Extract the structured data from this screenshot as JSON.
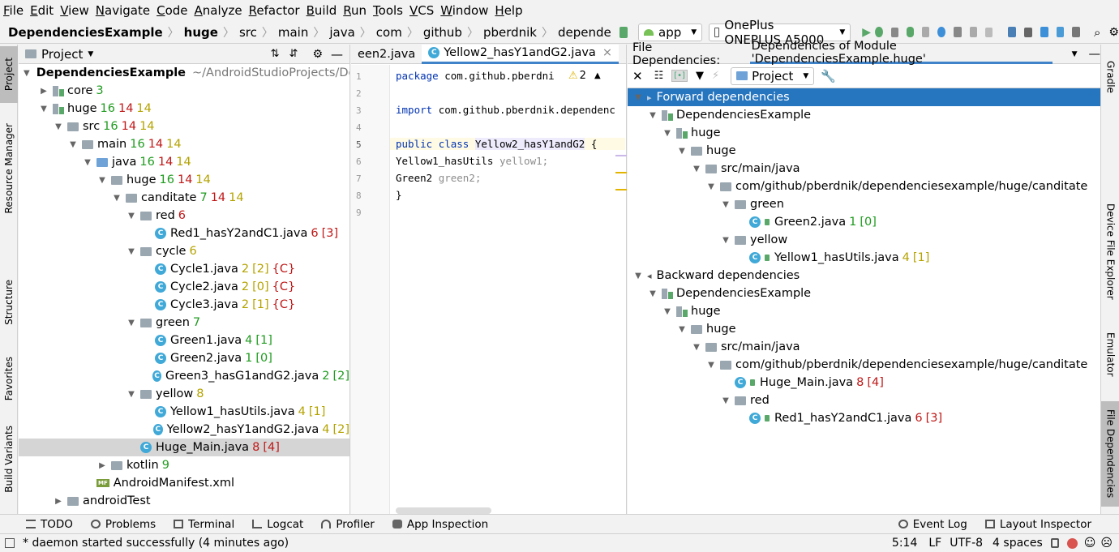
{
  "menu": [
    "File",
    "Edit",
    "View",
    "Navigate",
    "Code",
    "Analyze",
    "Refactor",
    "Build",
    "Run",
    "Tools",
    "VCS",
    "Window",
    "Help"
  ],
  "breadcrumbs": [
    "DependenciesExample",
    "huge",
    "src",
    "main",
    "java",
    "com",
    "github",
    "pberdnik",
    "depende"
  ],
  "toolbar": {
    "run_config": "app",
    "device": "OnePlus ONEPLUS A5000"
  },
  "left_tabs": [
    "Project",
    "Resource Manager",
    "Structure",
    "Favorites",
    "Build Variants"
  ],
  "right_tabs": [
    "Gradle",
    "Device File Explorer",
    "Emulator",
    "File Dependencies"
  ],
  "project": {
    "header": "Project",
    "root": {
      "name": "DependenciesExample",
      "path": "~/AndroidStudioProjects/Dep"
    },
    "rows": [
      {
        "label": "core",
        "nums": [
          [
            "3",
            "cg"
          ]
        ]
      },
      {
        "label": "huge",
        "nums": [
          [
            "16",
            "cg"
          ],
          [
            "14",
            "cr"
          ],
          [
            "14",
            "cy"
          ]
        ]
      },
      {
        "label": "src",
        "nums": [
          [
            "16",
            "cg"
          ],
          [
            "14",
            "cr"
          ],
          [
            "14",
            "cy"
          ]
        ]
      },
      {
        "label": "main",
        "nums": [
          [
            "16",
            "cg"
          ],
          [
            "14",
            "cr"
          ],
          [
            "14",
            "cy"
          ]
        ]
      },
      {
        "label": "java",
        "nums": [
          [
            "16",
            "cg"
          ],
          [
            "14",
            "cr"
          ],
          [
            "14",
            "cy"
          ]
        ]
      },
      {
        "label": "huge",
        "nums": [
          [
            "16",
            "cg"
          ],
          [
            "14",
            "cr"
          ],
          [
            "14",
            "cy"
          ]
        ]
      },
      {
        "label": "canditate",
        "nums": [
          [
            "7",
            "cg"
          ],
          [
            "14",
            "cr"
          ],
          [
            "14",
            "cy"
          ]
        ]
      },
      {
        "label": "red",
        "nums": [
          [
            "6",
            "cr"
          ]
        ]
      },
      {
        "label": "Red1_hasY2andC1.java",
        "nums": [
          [
            "6",
            "cr"
          ],
          [
            "[3]",
            "cr"
          ]
        ]
      },
      {
        "label": "cycle",
        "nums": [
          [
            "6",
            "cy"
          ]
        ]
      },
      {
        "label": "Cycle1.java",
        "nums": [
          [
            "2",
            "cy"
          ],
          [
            "[2]",
            "cy"
          ],
          [
            "{C}",
            "cr"
          ]
        ]
      },
      {
        "label": "Cycle2.java",
        "nums": [
          [
            "2",
            "cy"
          ],
          [
            "[0]",
            "cy"
          ],
          [
            "{C}",
            "cr"
          ]
        ]
      },
      {
        "label": "Cycle3.java",
        "nums": [
          [
            "2",
            "cy"
          ],
          [
            "[1]",
            "cy"
          ],
          [
            "{C}",
            "cr"
          ]
        ]
      },
      {
        "label": "green",
        "nums": [
          [
            "7",
            "cg"
          ]
        ]
      },
      {
        "label": "Green1.java",
        "nums": [
          [
            "4",
            "cg"
          ],
          [
            "[1]",
            "cg"
          ]
        ]
      },
      {
        "label": "Green2.java",
        "nums": [
          [
            "1",
            "cg"
          ],
          [
            "[0]",
            "cg"
          ]
        ]
      },
      {
        "label": "Green3_hasG1andG2.java",
        "nums": [
          [
            "2",
            "cg"
          ],
          [
            "[2]",
            "cg"
          ]
        ]
      },
      {
        "label": "yellow",
        "nums": [
          [
            "8",
            "cy"
          ]
        ]
      },
      {
        "label": "Yellow1_hasUtils.java",
        "nums": [
          [
            "4",
            "cy"
          ],
          [
            "[1]",
            "cy"
          ]
        ]
      },
      {
        "label": "Yellow2_hasY1andG2.java",
        "nums": [
          [
            "4",
            "cy"
          ],
          [
            "[2]",
            "cy"
          ]
        ]
      },
      {
        "label": "Huge_Main.java",
        "nums": [
          [
            "8",
            "cr"
          ],
          [
            "[4]",
            "cr"
          ]
        ]
      },
      {
        "label": "kotlin",
        "nums": [
          [
            "9",
            "cg"
          ]
        ]
      },
      {
        "label": "AndroidManifest.xml",
        "nums": []
      },
      {
        "label": "androidTest",
        "nums": []
      }
    ]
  },
  "editor": {
    "tabs": [
      "een2.java",
      "Yellow2_hasY1andG2.java"
    ],
    "line_numbers": [
      "1",
      "2",
      "3",
      "4",
      "5",
      "6",
      "7",
      "8",
      "9"
    ],
    "lines": [
      "package com.github.pberdni",
      "",
      "import com.github.pberdnik.dependenc",
      "",
      "public class Yellow2_hasY1andG2 {",
      "    Yellow1_hasUtils yellow1;",
      "    Green2 green2;",
      "}",
      ""
    ],
    "warning_count": "2"
  },
  "deps": {
    "tab_label": "File Dependencies:",
    "tab_title": "Dependencies of Module 'DependenciesExample.huge'",
    "scope": "Project",
    "rows": [
      {
        "label": "Forward dependencies",
        "nums": []
      },
      {
        "label": "DependenciesExample",
        "nums": []
      },
      {
        "label": "huge",
        "nums": []
      },
      {
        "label": "huge",
        "nums": []
      },
      {
        "label": "src/main/java",
        "nums": []
      },
      {
        "label": "com/github/pberdnik/dependenciesexample/huge/canditate",
        "nums": []
      },
      {
        "label": "green",
        "nums": []
      },
      {
        "label": "Green2.java",
        "nums": [
          [
            "1",
            "cg"
          ],
          [
            "[0]",
            "cg"
          ]
        ]
      },
      {
        "label": "yellow",
        "nums": []
      },
      {
        "label": "Yellow1_hasUtils.java",
        "nums": [
          [
            "4",
            "cy"
          ],
          [
            "[1]",
            "cy"
          ]
        ]
      },
      {
        "label": "Backward dependencies",
        "nums": []
      },
      {
        "label": "DependenciesExample",
        "nums": []
      },
      {
        "label": "huge",
        "nums": []
      },
      {
        "label": "huge",
        "nums": []
      },
      {
        "label": "src/main/java",
        "nums": []
      },
      {
        "label": "com/github/pberdnik/dependenciesexample/huge/canditate",
        "nums": []
      },
      {
        "label": "Huge_Main.java",
        "nums": [
          [
            "8",
            "cr"
          ],
          [
            "[4]",
            "cr"
          ]
        ]
      },
      {
        "label": "red",
        "nums": []
      },
      {
        "label": "Red1_hasY2andC1.java",
        "nums": [
          [
            "6",
            "cr"
          ],
          [
            "[3]",
            "cr"
          ]
        ]
      }
    ]
  },
  "bottom_tools": [
    "TODO",
    "Problems",
    "Terminal",
    "Logcat",
    "Profiler",
    "App Inspection"
  ],
  "bottom_right_tools": [
    "Event Log",
    "Layout Inspector"
  ],
  "status": {
    "message": "* daemon started successfully (4 minutes ago)",
    "position": "5:14",
    "line_sep": "LF",
    "encoding": "UTF-8",
    "indent": "4 spaces"
  },
  "colors": {
    "accent": "#2675bf",
    "green": "#1f9b1f",
    "red": "#c01818",
    "yellow": "#b4a300"
  }
}
